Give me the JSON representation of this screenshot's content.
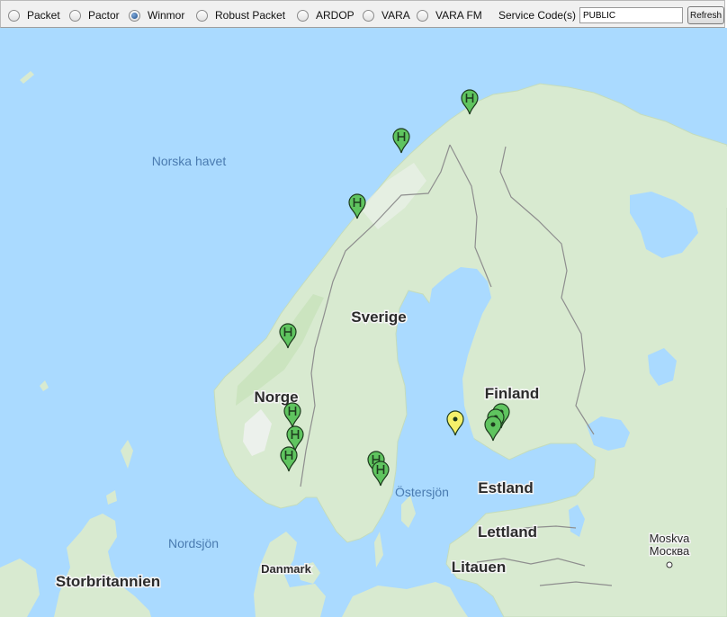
{
  "toolbar": {
    "modes": [
      {
        "label": "Packet",
        "selected": false
      },
      {
        "label": "Pactor",
        "selected": false
      },
      {
        "label": "Winmor",
        "selected": true
      },
      {
        "label": "Robust Packet",
        "selected": false
      },
      {
        "label": "ARDOP",
        "selected": false
      },
      {
        "label": "VARA",
        "selected": false
      },
      {
        "label": "VARA FM",
        "selected": false
      }
    ],
    "service_code_label": "Service Code(s)",
    "service_code_value": "PUBLIC",
    "refresh_label": "Refresh"
  },
  "map": {
    "colors": {
      "water": "#aadaff",
      "land": "#d8ead0",
      "land_dark": "#cbe4bf",
      "snow": "#eef2ee",
      "border": "#8e8e8e"
    },
    "seas": {
      "norwegian_sea": "Norska havet",
      "baltic_sea": "Östersjön",
      "north_sea": "Nordsjön"
    },
    "countries": {
      "sweden": "Sverige",
      "norway": "Norge",
      "finland": "Finland",
      "estonia": "Estland",
      "latvia": "Lettland",
      "lithuania": "Litauen",
      "denmark": "Danmark",
      "uk": "Storbritannien"
    },
    "cities": {
      "moscow_latin": "Moskva",
      "moscow_cyrillic": "Москва"
    },
    "markers": [
      {
        "id": "m1",
        "kind": "H",
        "color": "green"
      },
      {
        "id": "m2",
        "kind": "H",
        "color": "green"
      },
      {
        "id": "m3",
        "kind": "H",
        "color": "green"
      },
      {
        "id": "m4",
        "kind": "H",
        "color": "green"
      },
      {
        "id": "m5",
        "kind": "H",
        "color": "green"
      },
      {
        "id": "m6",
        "kind": "H",
        "color": "green"
      },
      {
        "id": "m7",
        "kind": "H",
        "color": "green"
      },
      {
        "id": "m8",
        "kind": "H",
        "color": "green"
      },
      {
        "id": "m9",
        "kind": "H",
        "color": "green"
      },
      {
        "id": "m10",
        "kind": "plain",
        "color": "yellow"
      },
      {
        "id": "m11",
        "kind": "plain",
        "color": "green"
      },
      {
        "id": "m12",
        "kind": "plain",
        "color": "green"
      },
      {
        "id": "m13",
        "kind": "plain",
        "color": "green"
      }
    ]
  }
}
